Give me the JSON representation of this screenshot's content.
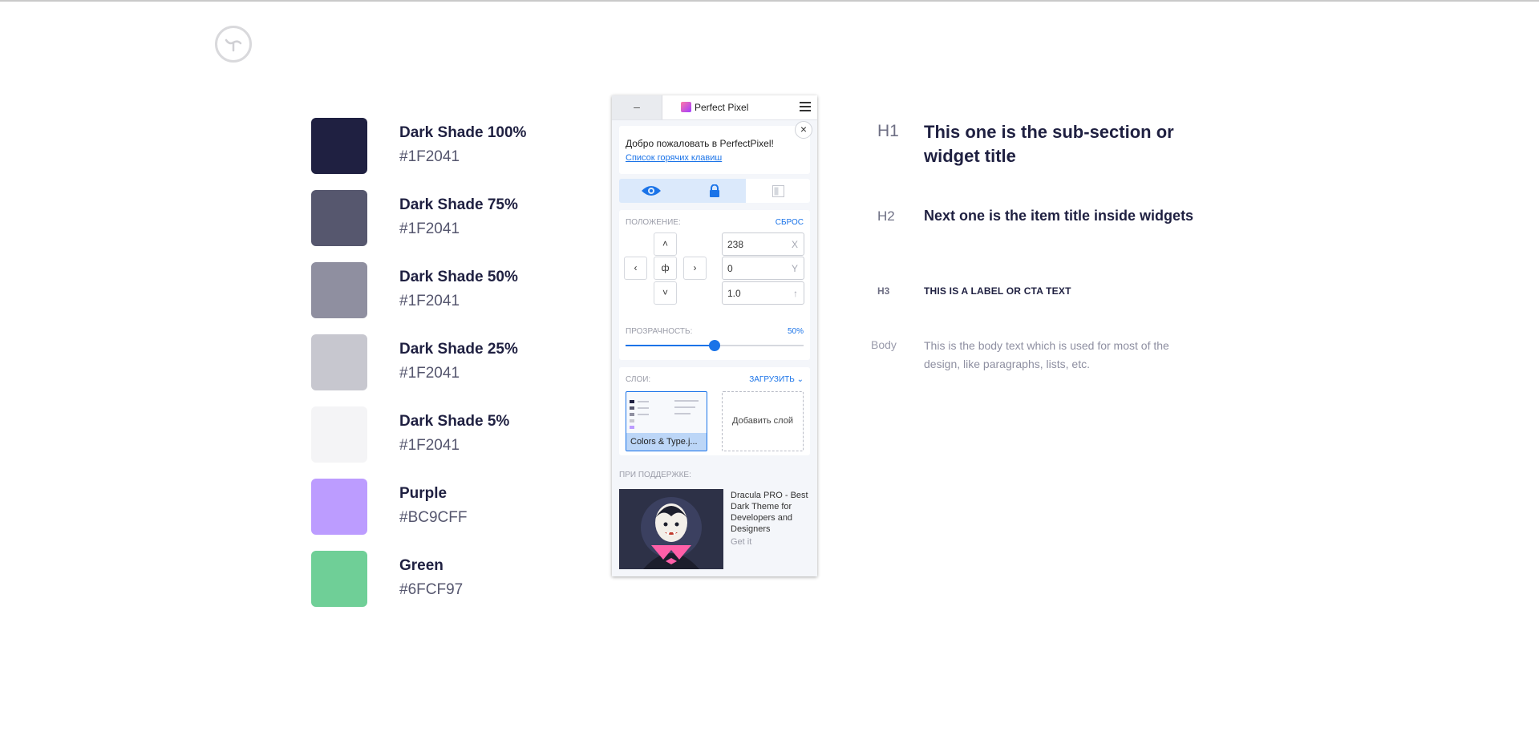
{
  "swatches": [
    {
      "name": "Dark Shade 100%",
      "hex": "#1F2041",
      "color": "#1F2041"
    },
    {
      "name": "Dark Shade 75%",
      "hex": "#1F2041",
      "color": "#56576e"
    },
    {
      "name": "Dark Shade 50%",
      "hex": "#1F2041",
      "color": "#8f8fa0"
    },
    {
      "name": "Dark Shade 25%",
      "hex": "#1F2041",
      "color": "#c7c7cf"
    },
    {
      "name": "Dark Shade 5%",
      "hex": "#1F2041",
      "color": "#f4f4f6"
    },
    {
      "name": "Purple",
      "hex": "#BC9CFF",
      "color": "#BC9CFF"
    },
    {
      "name": "Green",
      "hex": "#6FCF97",
      "color": "#6FCF97"
    }
  ],
  "typography": {
    "h1": {
      "tag": "H1",
      "text": "This one is the sub-section or widget title"
    },
    "h2": {
      "tag": "H2",
      "text": "Next one is the item title inside widgets"
    },
    "h3": {
      "tag": "H3",
      "text": "THIS IS A LABEL OR CTA TEXT"
    },
    "body": {
      "tag": "Body",
      "text": "This is the body text which is used for most of the design, like paragraphs, lists, etc."
    }
  },
  "panel": {
    "minimize_label": "–",
    "title": "Perfect Pixel",
    "welcome": {
      "text": "Добро пожаловать в PerfectPixel!",
      "link": "Список горячих клавиш",
      "close": "×"
    },
    "position": {
      "label": "ПОЛОЖЕНИЕ:",
      "reset": "СБРОС",
      "x_value": "238",
      "x_unit": "X",
      "y_value": "0",
      "y_unit": "Y",
      "scale_value": "1.0",
      "scale_unit": "↑",
      "up": "˄",
      "down": "˅",
      "left": "‹",
      "right": "›",
      "center": "ф"
    },
    "opacity": {
      "label": "ПРОЗРАЧНОСТЬ:",
      "value_text": "50%",
      "value": 0.5
    },
    "layers": {
      "label": "СЛОИ:",
      "upload": "ЗАГРУЗИТЬ",
      "layer_name": "Colors & Type.j...",
      "add_layer": "Добавить слой"
    },
    "sponsor": {
      "label": "ПРИ ПОДДЕРЖКЕ:",
      "text": "Dracula PRO - Best Dark Theme for Developers and Designers",
      "cta": "Get it"
    },
    "accent": "#1a73e8"
  }
}
